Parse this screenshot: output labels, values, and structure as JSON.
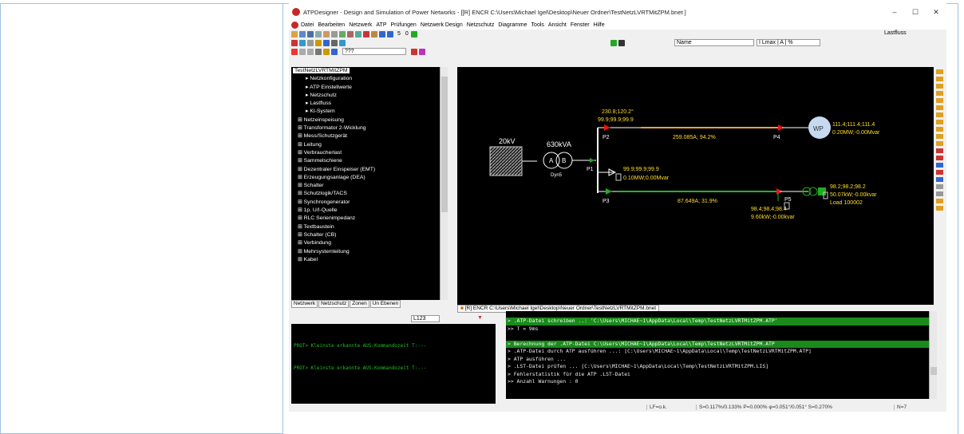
{
  "window": {
    "title": "ATPDesigner - Design and Simulation of Power Networks - [[R] ENCR C:\\Users\\Michael Igel\\Desktop\\Neuer Ordner\\TestNetzLVRTMitZPM.bnet ]"
  },
  "menu": [
    "Datei",
    "Bearbeiten",
    "Netzwerk",
    "ATP",
    "Prüfungen",
    "Netzwerk Design",
    "Netzschutz",
    "Diagramme",
    "Tools",
    "Ansicht",
    "Fenster",
    "Hilfe"
  ],
  "toolbar": {
    "counter1": "5",
    "counter2": "0",
    "lastfluss": "Lastfluss",
    "field_text": "???",
    "name_dropdown": "Name",
    "unit_dropdown": "I Lmax | A | %"
  },
  "tree": {
    "root": "TestNetzLVRTMitZPM",
    "items": [
      "Netzkonfiguration",
      "ATP Einstellwerte",
      "Netzschutz",
      "Lastfluss",
      "KI-System",
      "Netzeinspeisung",
      "Transformator 2-Wicklung",
      "Mess/Schutzgerät",
      "Leitung",
      "Verbraucherlast",
      "Sammelschiene",
      "Dezentraler Einspeiser (EMT)",
      "Erzeugungsanlage (DEA)",
      "Schalter",
      "Schutzlogik/TACS",
      "Synchrongenerator",
      "1p. U/I-Quelle",
      "RLC Serienimpedanz",
      "Textbaustein",
      "Schalter (CB)",
      "Verbindung",
      "Mehrsystemleitung",
      "Kabel"
    ]
  },
  "tabs": [
    "Netzwerk",
    "Netzschutz",
    "Zonen",
    "Un Ebenen"
  ],
  "doc_tab": "[R] ENCR C:\\Users\\Michael Igel\\Desktop\\Neuer Ordner\\TestNetzLVRTMitZPM.bnet",
  "diagram": {
    "source_label": "20kV",
    "trafo_label": "630kVA",
    "trafo_a": "A",
    "trafo_b": "B",
    "trafo_vg": "Dyn5",
    "p1": "P1",
    "p2": "P2",
    "p3": "P3",
    "p4": "P4",
    "p5": "P5",
    "p2_v1": "230.8;120.2°",
    "p2_v2": "99.9;99.9;99.9",
    "line_top": "259.085A; 94.2%",
    "wp": "WP",
    "wp_v1": "111.4;111.4;111.4",
    "wp_v2": "0.20MW;-0.00Mvar",
    "p1_v1": "99.9;99.9;99.9",
    "p1_v2": "0.10MW;0.00Mvar",
    "line_bot": "87.649A; 31.9%",
    "p5_v1": "98.4;98.4;98.4",
    "p5_v2": "9.60kW;-0.00kvar",
    "load_v1": "98.2;98.2;98.2",
    "load_v2": "50.07kW;-0.00kvar",
    "load_name": "Load 100002"
  },
  "console_toolbar": {
    "field": "L123"
  },
  "console1": [
    "PROT> Kleinste erkannte AUS-Kommandozeit T:---",
    "PROT> Kleinste erkannte AUS-Kommandozeit T:---"
  ],
  "console2": [
    {
      "t": "> .ATP-Datei schreiben ..: 'C:\\Users\\MICHAE~1\\AppData\\Local\\Temp\\TestNetzLVRTMitZPM.ATP'",
      "g": true
    },
    {
      "t": ">> T = 9ms",
      "g": false
    },
    {
      "t": "",
      "g": false
    },
    {
      "t": "> Berechnung der .ATP-Datei C:\\Users\\MICHAE~1\\AppData\\Local\\Temp\\TestNetzLVRTMitZPM.ATP",
      "g": true
    },
    {
      "t": "> .ATP-Datei durch ATP ausführen ...: [C:\\Users\\MICHAE~1\\AppData\\Local\\Temp\\TestNetzLVRTMitZPM.ATP]",
      "g": false
    },
    {
      "t": "> ATP ausführen ...",
      "g": false
    },
    {
      "t": "> .LST-Datei prüfen ...  [C:\\Users\\MICHAE~1\\AppData\\Local\\Temp\\TestNetzLVRTMitZPM.LIS]",
      "g": false
    },
    {
      "t": "> Fehlerstatistik für die ATP .LST-Datei",
      "g": false
    },
    {
      "t": ">> Anzahl Warnungen : 0",
      "g": false
    }
  ],
  "status": {
    "lf": "LF=o.k.",
    "s": "S=0.117%/0.133% P=0.000% φ=0.051°/0.051° S=0.270%",
    "n": "N=7"
  }
}
